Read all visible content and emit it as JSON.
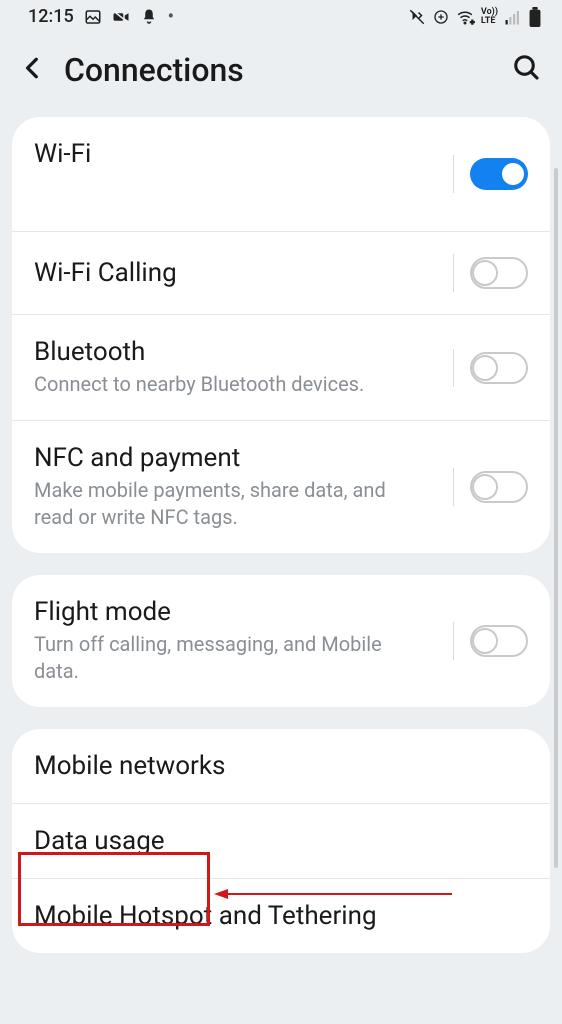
{
  "status_bar": {
    "time": "12:15",
    "lte_label": "Vo))\nLTE"
  },
  "header": {
    "title": "Connections"
  },
  "groups": [
    {
      "items": [
        {
          "key": "wifi",
          "title": "Wi-Fi",
          "subtitle": "",
          "toggle": "on",
          "show_wifi_placeholder": true
        },
        {
          "key": "wifi_calling",
          "title": "Wi-Fi Calling",
          "subtitle": "",
          "toggle": "off"
        },
        {
          "key": "bluetooth",
          "title": "Bluetooth",
          "subtitle": "Connect to nearby Bluetooth devices.",
          "toggle": "off"
        },
        {
          "key": "nfc",
          "title": "NFC and payment",
          "subtitle": "Make mobile payments, share data, and read or write NFC tags.",
          "toggle": "off"
        }
      ]
    },
    {
      "items": [
        {
          "key": "flight_mode",
          "title": "Flight mode",
          "subtitle": "Turn off calling, messaging, and Mobile data.",
          "toggle": "off"
        }
      ]
    },
    {
      "items": [
        {
          "key": "mobile_networks",
          "title": "Mobile networks",
          "subtitle": "",
          "toggle": null
        },
        {
          "key": "data_usage",
          "title": "Data usage",
          "subtitle": "",
          "toggle": null,
          "highlighted": true
        },
        {
          "key": "hotspot",
          "title": "Mobile Hotspot and Tethering",
          "subtitle": "",
          "toggle": null
        }
      ]
    }
  ]
}
